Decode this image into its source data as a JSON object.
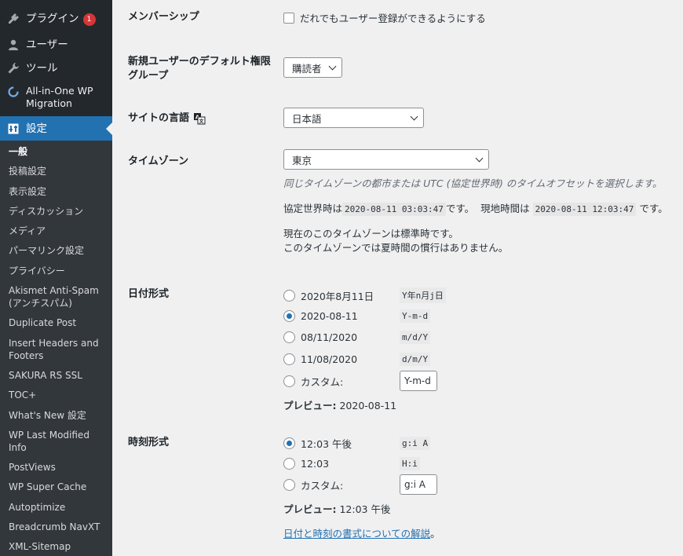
{
  "sidebar": {
    "plugins": {
      "label": "プラグイン",
      "badge": "1"
    },
    "users": {
      "label": "ユーザー"
    },
    "tools": {
      "label": "ツール"
    },
    "aiowp": {
      "label": "All-in-One WP Migration"
    },
    "settings": {
      "label": "設定"
    },
    "submenu": [
      "一般",
      "投稿設定",
      "表示設定",
      "ディスカッション",
      "メディア",
      "パーマリンク設定",
      "プライバシー",
      "Akismet Anti-Spam (アンチスパム)",
      "Duplicate Post",
      "Insert Headers and Footers",
      "SAKURA RS SSL",
      "TOC+",
      "What's New 設定",
      "WP Last Modified Info",
      "PostViews",
      "WP Super Cache",
      "Autoptimize",
      "Breadcrumb NavXT",
      "XML-Sitemap"
    ]
  },
  "membership": {
    "label": "メンバーシップ",
    "checkbox_label": "だれでもユーザー登録ができるようにする"
  },
  "default_role": {
    "label": "新規ユーザーのデフォルト権限グループ",
    "value": "購読者"
  },
  "site_language": {
    "label": "サイトの言語",
    "value": "日本語"
  },
  "timezone": {
    "label": "タイムゾーン",
    "value": "東京",
    "description": "同じタイムゾーンの都市または UTC (協定世界時) のタイムオフセットを選択します。",
    "utc_prefix": "協定世界時は",
    "utc_time": "2020-08-11 03:03:47",
    "utc_suffix": "です。",
    "local_prefix": "現地時間は",
    "local_time": "2020-08-11 12:03:47",
    "local_suffix": "です。",
    "standard_note": "現在のこのタイムゾーンは標準時です。",
    "dst_note": "このタイムゾーンでは夏時間の慣行はありません。"
  },
  "date_format": {
    "label": "日付形式",
    "options": [
      {
        "display": "2020年8月11日",
        "code": "Y年n月j日",
        "selected": false
      },
      {
        "display": "2020-08-11",
        "code": "Y-m-d",
        "selected": true
      },
      {
        "display": "08/11/2020",
        "code": "m/d/Y",
        "selected": false
      },
      {
        "display": "11/08/2020",
        "code": "d/m/Y",
        "selected": false
      }
    ],
    "custom_label": "カスタム:",
    "custom_value": "Y-m-d",
    "preview_label": "プレビュー:",
    "preview_value": "2020-08-11"
  },
  "time_format": {
    "label": "時刻形式",
    "options": [
      {
        "display": "12:03 午後",
        "code": "g:i A",
        "selected": true
      },
      {
        "display": "12:03",
        "code": "H:i",
        "selected": false
      }
    ],
    "custom_label": "カスタム:",
    "custom_value": "g:i A",
    "preview_label": "プレビュー:",
    "preview_value": "12:03 午後",
    "doc_link": "日付と時刻の書式についての解説",
    "doc_link_suffix": "。"
  },
  "colors": {
    "accent": "#2271b1",
    "sidebar_bg": "#23282d",
    "submenu_bg": "#32373c",
    "badge": "#d63638"
  }
}
